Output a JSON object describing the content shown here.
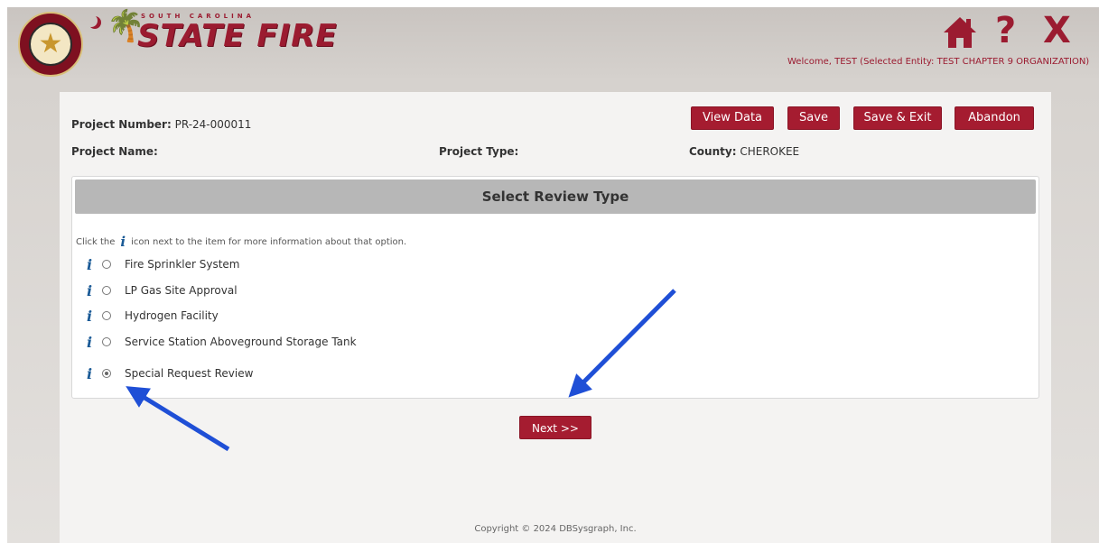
{
  "header": {
    "brand_small": "SOUTH CAROLINA",
    "brand": "STATE FIRE",
    "welcome": "Welcome, TEST (Selected Entity: TEST CHAPTER 9 ORGANIZATION)",
    "help_glyph": "?",
    "close_glyph": "X"
  },
  "project": {
    "number_label": "Project Number:",
    "number_value": "PR-24-000011",
    "name_label": "Project Name:",
    "type_label": "Project Type:",
    "county_label": "County:",
    "county_value": "CHEROKEE"
  },
  "actions": {
    "view_data": "View Data",
    "save": "Save",
    "save_exit": "Save & Exit",
    "abandon": "Abandon"
  },
  "review": {
    "title": "Select Review Type",
    "hint_before": "Click the",
    "hint_after": "icon next to the item for more information about that option.",
    "options": [
      {
        "label": "Fire Sprinkler System",
        "selected": false
      },
      {
        "label": "LP Gas Site Approval",
        "selected": false
      },
      {
        "label": "Hydrogen Facility",
        "selected": false
      },
      {
        "label": "Service Station Aboveground Storage Tank",
        "selected": false
      },
      {
        "label": "Special Request Review",
        "selected": true
      }
    ]
  },
  "next_label": "Next >>",
  "copyright": "Copyright © 2024 DBSysgraph, Inc.",
  "colors": {
    "accent": "#a51c30",
    "info_icon": "#1a5a96",
    "annotation_arrow": "#1f4fd6"
  }
}
